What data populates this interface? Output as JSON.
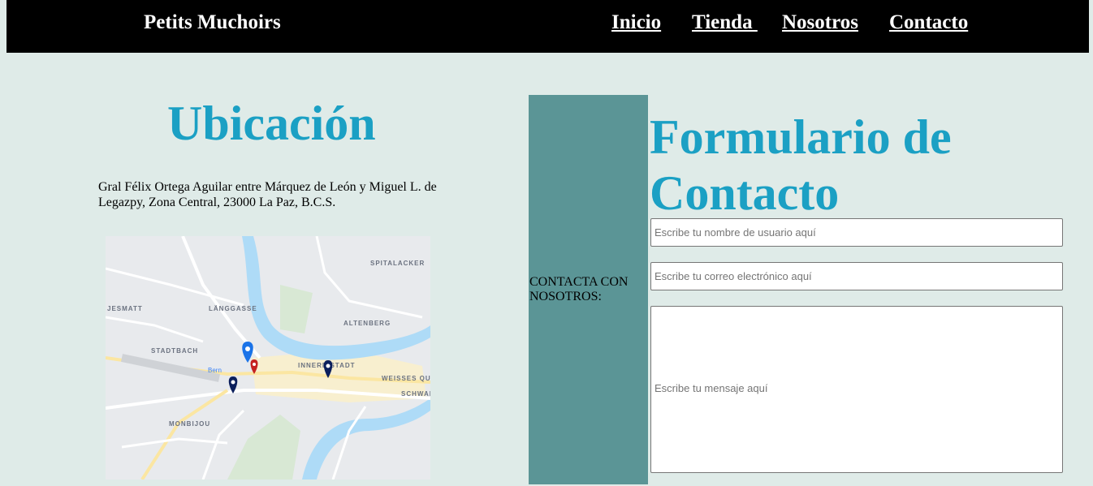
{
  "nav": {
    "brand": "Petits Muchoirs",
    "links": [
      "Inicio",
      "Tienda ",
      "Nosotros",
      "Contacto"
    ]
  },
  "location": {
    "title": "Ubicación",
    "address": "Gral Félix Ortega Aguilar entre Márquez de León y Miguel L. de Legazpy, Zona Central, 23000 La Paz, B.C.S.",
    "map_labels": [
      "SPITALACKER",
      "LÄNGGASSE",
      "ALTENBERG",
      "JESMATT",
      "STADTBACH",
      "INNERE STADT",
      "WEISSES QUARTIER",
      "SCHWARZTOR QUARTIER",
      "MONBIJOU",
      "Bern"
    ]
  },
  "sidebar": {
    "text": "CONTACTA CON NOSOTROS:"
  },
  "form": {
    "title": "Formulario de Contacto",
    "username_placeholder": "Escribe tu nombre de usuario aquí",
    "email_placeholder": "Escribe tu correo electrónico aquí",
    "message_placeholder": "Escribe tu mensaje aquí"
  },
  "colors": {
    "background": "#dfebe8",
    "navbar": "#000000",
    "title_blue": "#1ba0c4",
    "sidebar": "#5b9596"
  }
}
